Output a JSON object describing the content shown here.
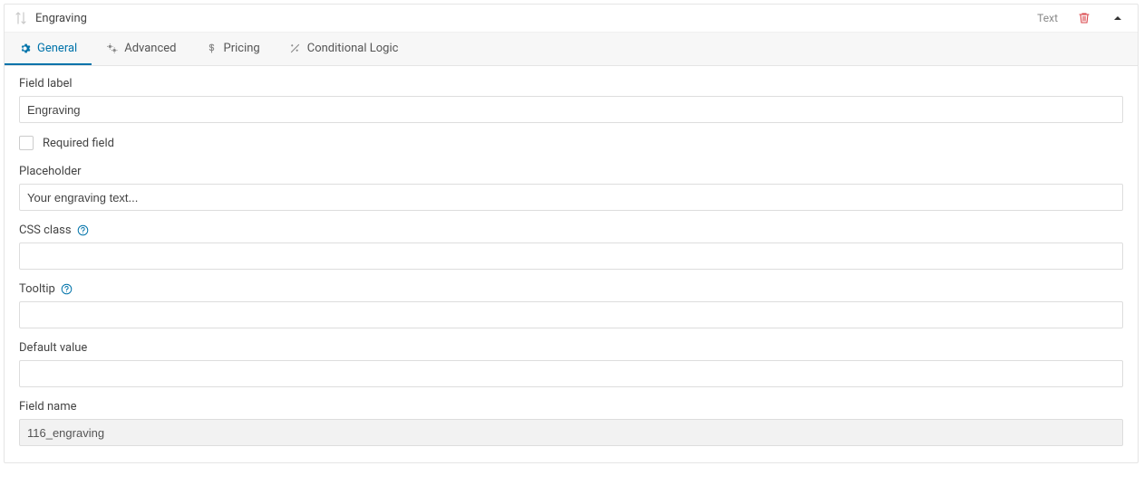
{
  "header": {
    "title": "Engraving",
    "field_type": "Text"
  },
  "tabs": [
    {
      "label": "General",
      "icon": "gear-icon",
      "active": true
    },
    {
      "label": "Advanced",
      "icon": "gears-icon",
      "active": false
    },
    {
      "label": "Pricing",
      "icon": "dollar-icon",
      "active": false
    },
    {
      "label": "Conditional Logic",
      "icon": "wand-icon",
      "active": false
    }
  ],
  "form": {
    "field_label": {
      "label": "Field label",
      "value": "Engraving"
    },
    "required": {
      "label": "Required field",
      "checked": false
    },
    "placeholder": {
      "label": "Placeholder",
      "value": "Your engraving text..."
    },
    "css_class": {
      "label": "CSS class",
      "value": "",
      "help": true
    },
    "tooltip": {
      "label": "Tooltip",
      "value": "",
      "help": true
    },
    "default_value": {
      "label": "Default value",
      "value": ""
    },
    "field_name": {
      "label": "Field name",
      "value": "116_engraving",
      "readonly": true
    }
  }
}
